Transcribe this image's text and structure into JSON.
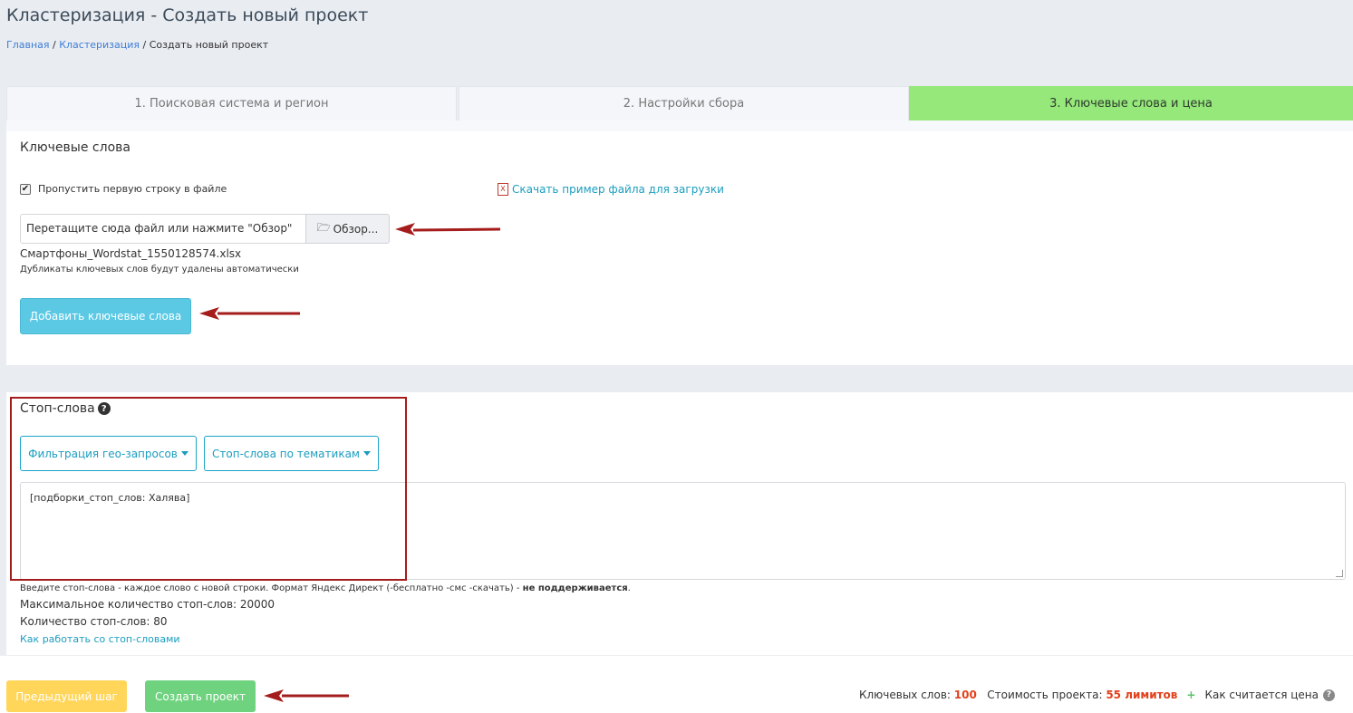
{
  "page_title": "Кластеризация - Создать новый проект",
  "breadcrumb": {
    "home": "Главная",
    "sep1": " / ",
    "section": "Кластеризация",
    "sep2": " / ",
    "current": "Создать новый проект"
  },
  "tabs": [
    {
      "label": "1. Поисковая система и регион"
    },
    {
      "label": "2. Настройки сбора"
    },
    {
      "label": "3. Ключевые слова и цена"
    }
  ],
  "keywords": {
    "title": "Ключевые слова",
    "skip_first_row_label": "Пропустить первую строку в файле",
    "skip_first_row_checked": true,
    "download_link": "Скачать пример файла для загрузки",
    "file_input_placeholder": "Перетащите сюда файл или нажмите \"Обзор\"",
    "browse_label": "Обзор...",
    "filename": "Смартфоны_Wordstat_1550128574.xlsx",
    "duplicates_note": "Дубликаты ключевых слов будут удалены автоматически",
    "add_button": "Добавить ключевые слова"
  },
  "stopwords": {
    "title": "Стоп-слова",
    "help": "?",
    "filter_geo_button": "Фильтрация гео-запросов",
    "topic_button": "Стоп-слова по тематикам",
    "textarea_value": "[подборки_стоп_слов: Халява]",
    "hint_text": "Введите стоп-слова - каждое слово с новой строки. Формат Яндекс Директ (-бесплатно -смс -скачать) - ",
    "hint_bold": "не поддерживается",
    "hint_end": ".",
    "max_count": "Максимальное количество стоп-слов: 20000",
    "count": "Количество стоп-слов: 80",
    "howto_link": "Как работать со стоп-словами"
  },
  "footer": {
    "prev_button": "Предыдущий шаг",
    "create_button": "Создать проект",
    "keywords_label": "Ключевых слов:",
    "keywords_value": "100",
    "cost_label": "Стоимость проекта:",
    "cost_value": "55 лимитов",
    "plus": "+",
    "price_link": "Как считается цена",
    "help": "?"
  },
  "colors": {
    "active_tab": "#96e87b",
    "accent_blue": "#1a9dbf",
    "add_button": "#5bc9e4",
    "prev_button": "#ffd55a",
    "create_button": "#6fd27f",
    "annotation_red": "#a51c1c"
  }
}
